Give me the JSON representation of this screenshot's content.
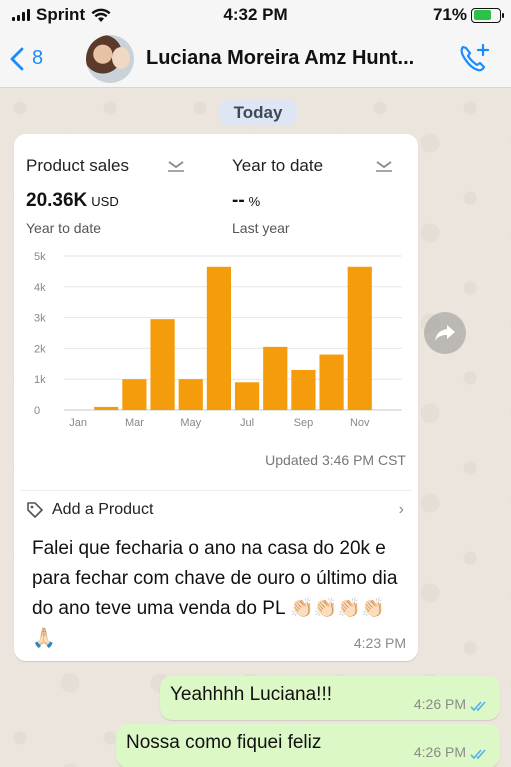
{
  "status_bar": {
    "carrier": "Sprint",
    "time": "4:32 PM",
    "battery": "71%",
    "battery_level": 0.71
  },
  "header": {
    "back_count": "8",
    "contact_name": "Luciana Moreira Amz Hunt..."
  },
  "chat": {
    "date_label": "Today",
    "incoming": {
      "screenshot": {
        "left_metric": "Product sales",
        "left_value": "20.36K",
        "left_unit": "USD",
        "left_sub": "Year to date",
        "right_metric": "Year to date",
        "right_value": "--",
        "right_unit": "%",
        "right_sub": "Last year",
        "updated": "Updated 3:46 PM CST",
        "add_product": "Add a Product"
      },
      "text": "Falei que fecharia o ano na casa do 20k e para fechar com chave de ouro o último dia do ano teve uma venda do PL 👏🏻👏🏻👏🏻👏🏻🙏🏻",
      "time": "4:23 PM"
    },
    "outgoing": [
      {
        "text": "Yeahhhh Luciana!!!",
        "time": "4:26 PM"
      },
      {
        "text": "Nossa como fiquei feliz",
        "time": "4:26 PM"
      }
    ]
  },
  "colors": {
    "bar": "#f59c0c",
    "link": "#1a8cff",
    "out_bubble": "#dcf8c6",
    "read_ticks": "#4fb3f0"
  },
  "chart_data": {
    "type": "bar",
    "categories": [
      "Jan",
      "Feb",
      "Mar",
      "Apr",
      "May",
      "Jun",
      "Jul",
      "Aug",
      "Sep",
      "Oct",
      "Nov",
      "Dec"
    ],
    "x_tick_labels": [
      "Jan",
      "Mar",
      "May",
      "Jul",
      "Sep",
      "Nov"
    ],
    "values": [
      0,
      100,
      1000,
      2950,
      1000,
      4650,
      900,
      2050,
      1300,
      1800,
      4650,
      0
    ],
    "y_ticks": [
      "0",
      "1k",
      "2k",
      "3k",
      "4k",
      "5k"
    ],
    "ylim": [
      0,
      5000
    ],
    "grid": true
  }
}
